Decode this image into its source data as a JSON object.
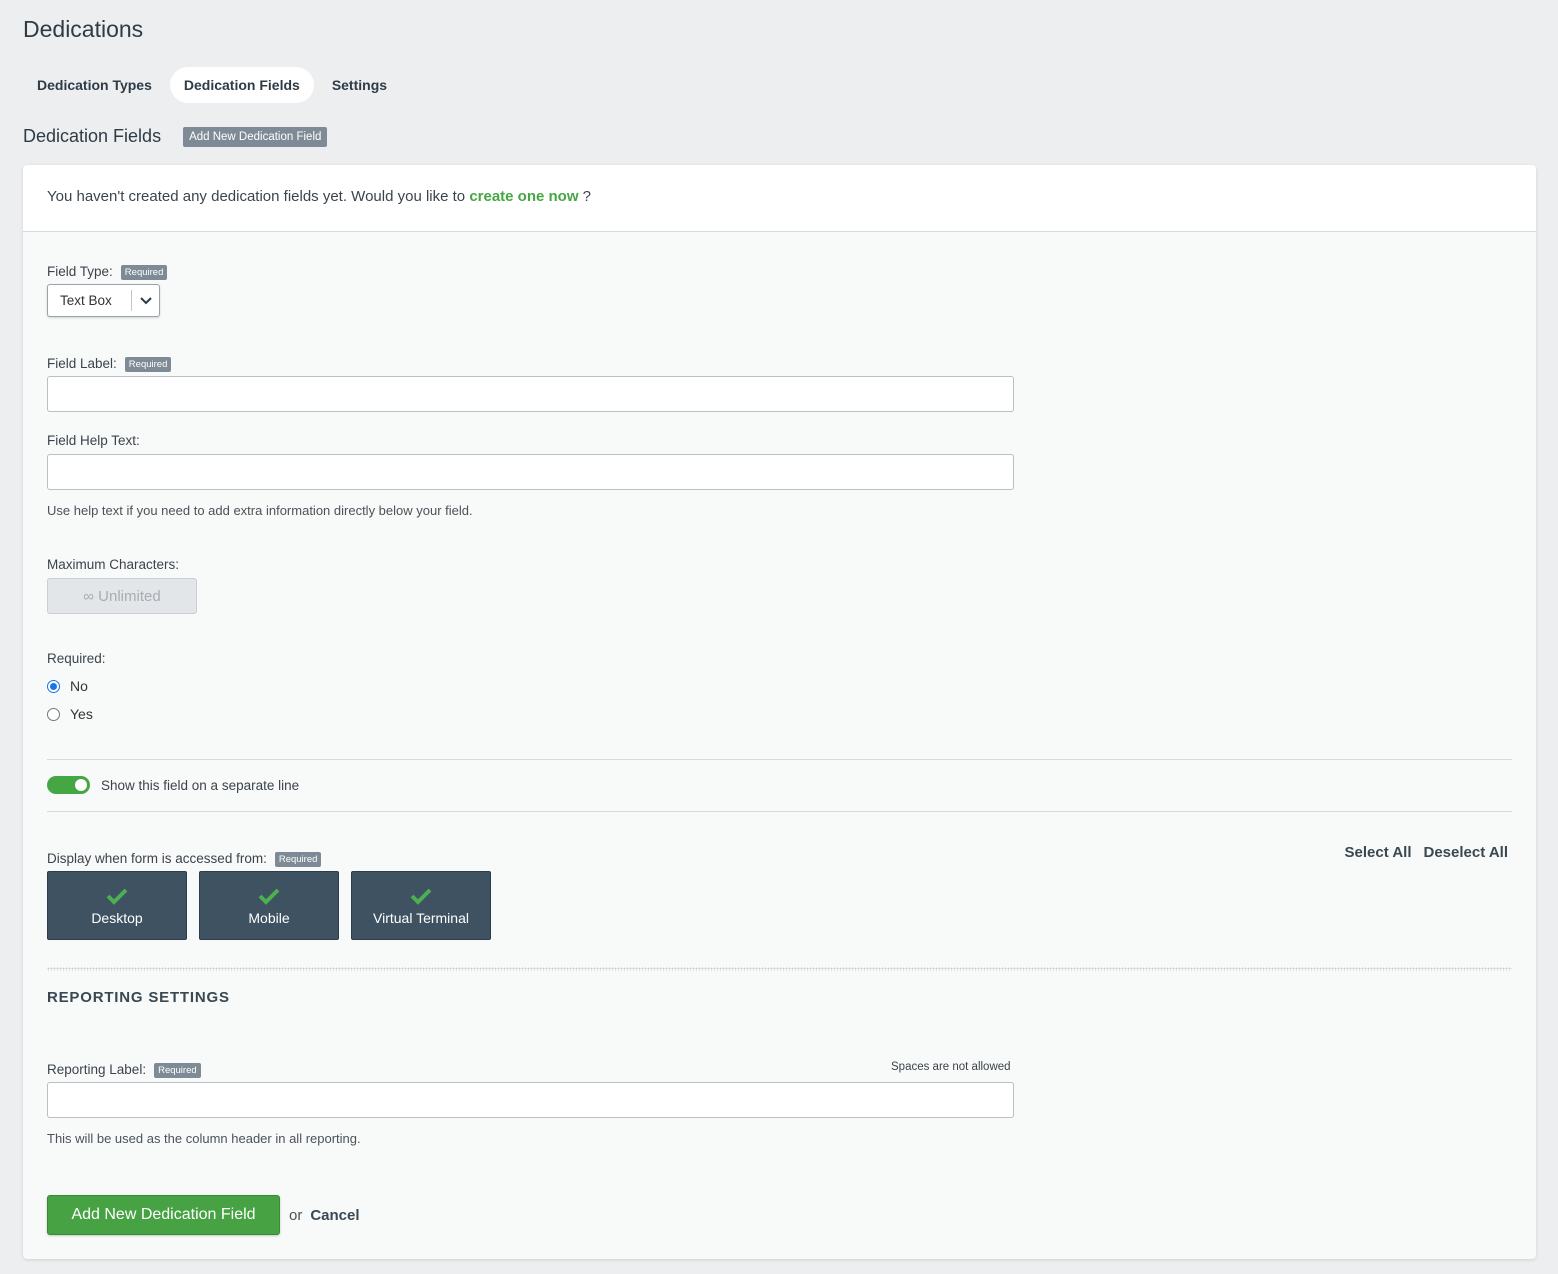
{
  "page": {
    "title": "Dedications"
  },
  "tabs": [
    {
      "label": "Dedication Types",
      "active": false
    },
    {
      "label": "Dedication Fields",
      "active": true
    },
    {
      "label": "Settings",
      "active": false
    }
  ],
  "section": {
    "title": "Dedication Fields",
    "add_button": "Add New Dedication Field"
  },
  "notice": {
    "text": "You haven't created any dedication fields yet. Would you like to ",
    "link": "create one now",
    "suffix": " ?"
  },
  "required_badge": "Required",
  "form": {
    "field_type": {
      "label": "Field Type:",
      "value": "Text Box"
    },
    "field_label": {
      "label": "Field Label:",
      "value": ""
    },
    "field_help_text": {
      "label": "Field Help Text:",
      "value": "",
      "help": "Use help text if you need to add extra information directly below your field."
    },
    "max_chars": {
      "label": "Maximum Characters:",
      "value": "∞ Unlimited"
    },
    "required": {
      "label": "Required:",
      "options": [
        "No",
        "Yes"
      ],
      "selected": "No"
    },
    "separate_line": {
      "label": "Show this field on a separate line",
      "on": true
    },
    "display_from": {
      "label": "Display when form is accessed from:",
      "select_all": "Select All",
      "deselect_all": "Deselect All",
      "options": [
        {
          "label": "Desktop",
          "checked": true
        },
        {
          "label": "Mobile",
          "checked": true
        },
        {
          "label": "Virtual Terminal",
          "checked": true
        }
      ]
    }
  },
  "reporting": {
    "title": "REPORTING SETTINGS",
    "label": "Reporting Label:",
    "note": "Spaces are not allowed",
    "value": "",
    "help": "This will be used as the column header in all reporting."
  },
  "actions": {
    "submit": "Add New Dedication Field",
    "or": "or",
    "cancel": "Cancel"
  },
  "colors": {
    "accent_green": "#45a644",
    "tile_bg": "#3e5261",
    "check_green": "#4caf50"
  }
}
